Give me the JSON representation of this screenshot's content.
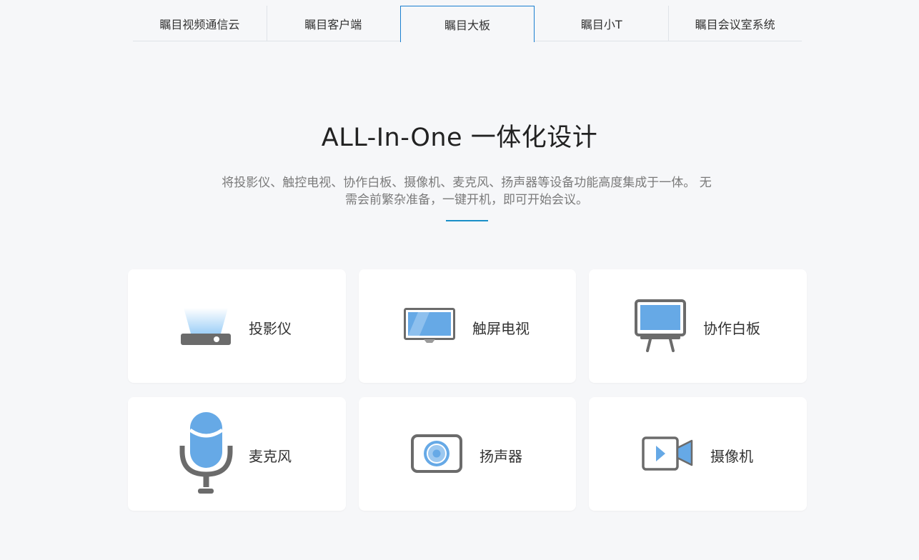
{
  "tabs": [
    {
      "label": "瞩目视频通信云",
      "active": false
    },
    {
      "label": "瞩目客户端",
      "active": false
    },
    {
      "label": "瞩目大板",
      "active": true
    },
    {
      "label": "瞩目小T",
      "active": false
    },
    {
      "label": "瞩目会议室系统",
      "active": false
    }
  ],
  "hero": {
    "title": "ALL-In-One 一体化设计",
    "description": "将投影仪、触控电视、协作白板、摄像机、麦克风、扬声器等设备功能高度集成于一体。 无需会前繁杂准备，一键开机，即可开始会议。"
  },
  "features": [
    {
      "label": "投影仪",
      "icon": "projector-icon"
    },
    {
      "label": "触屏电视",
      "icon": "touchscreen-tv-icon"
    },
    {
      "label": "协作白板",
      "icon": "whiteboard-icon"
    },
    {
      "label": "麦克风",
      "icon": "microphone-icon"
    },
    {
      "label": "扬声器",
      "icon": "speaker-icon"
    },
    {
      "label": "摄像机",
      "icon": "camera-icon"
    }
  ],
  "colors": {
    "accent": "#1a7fd0",
    "icon_blue": "#66a9e6",
    "icon_gray": "#6b6b6b",
    "background": "#f6f7f9"
  }
}
